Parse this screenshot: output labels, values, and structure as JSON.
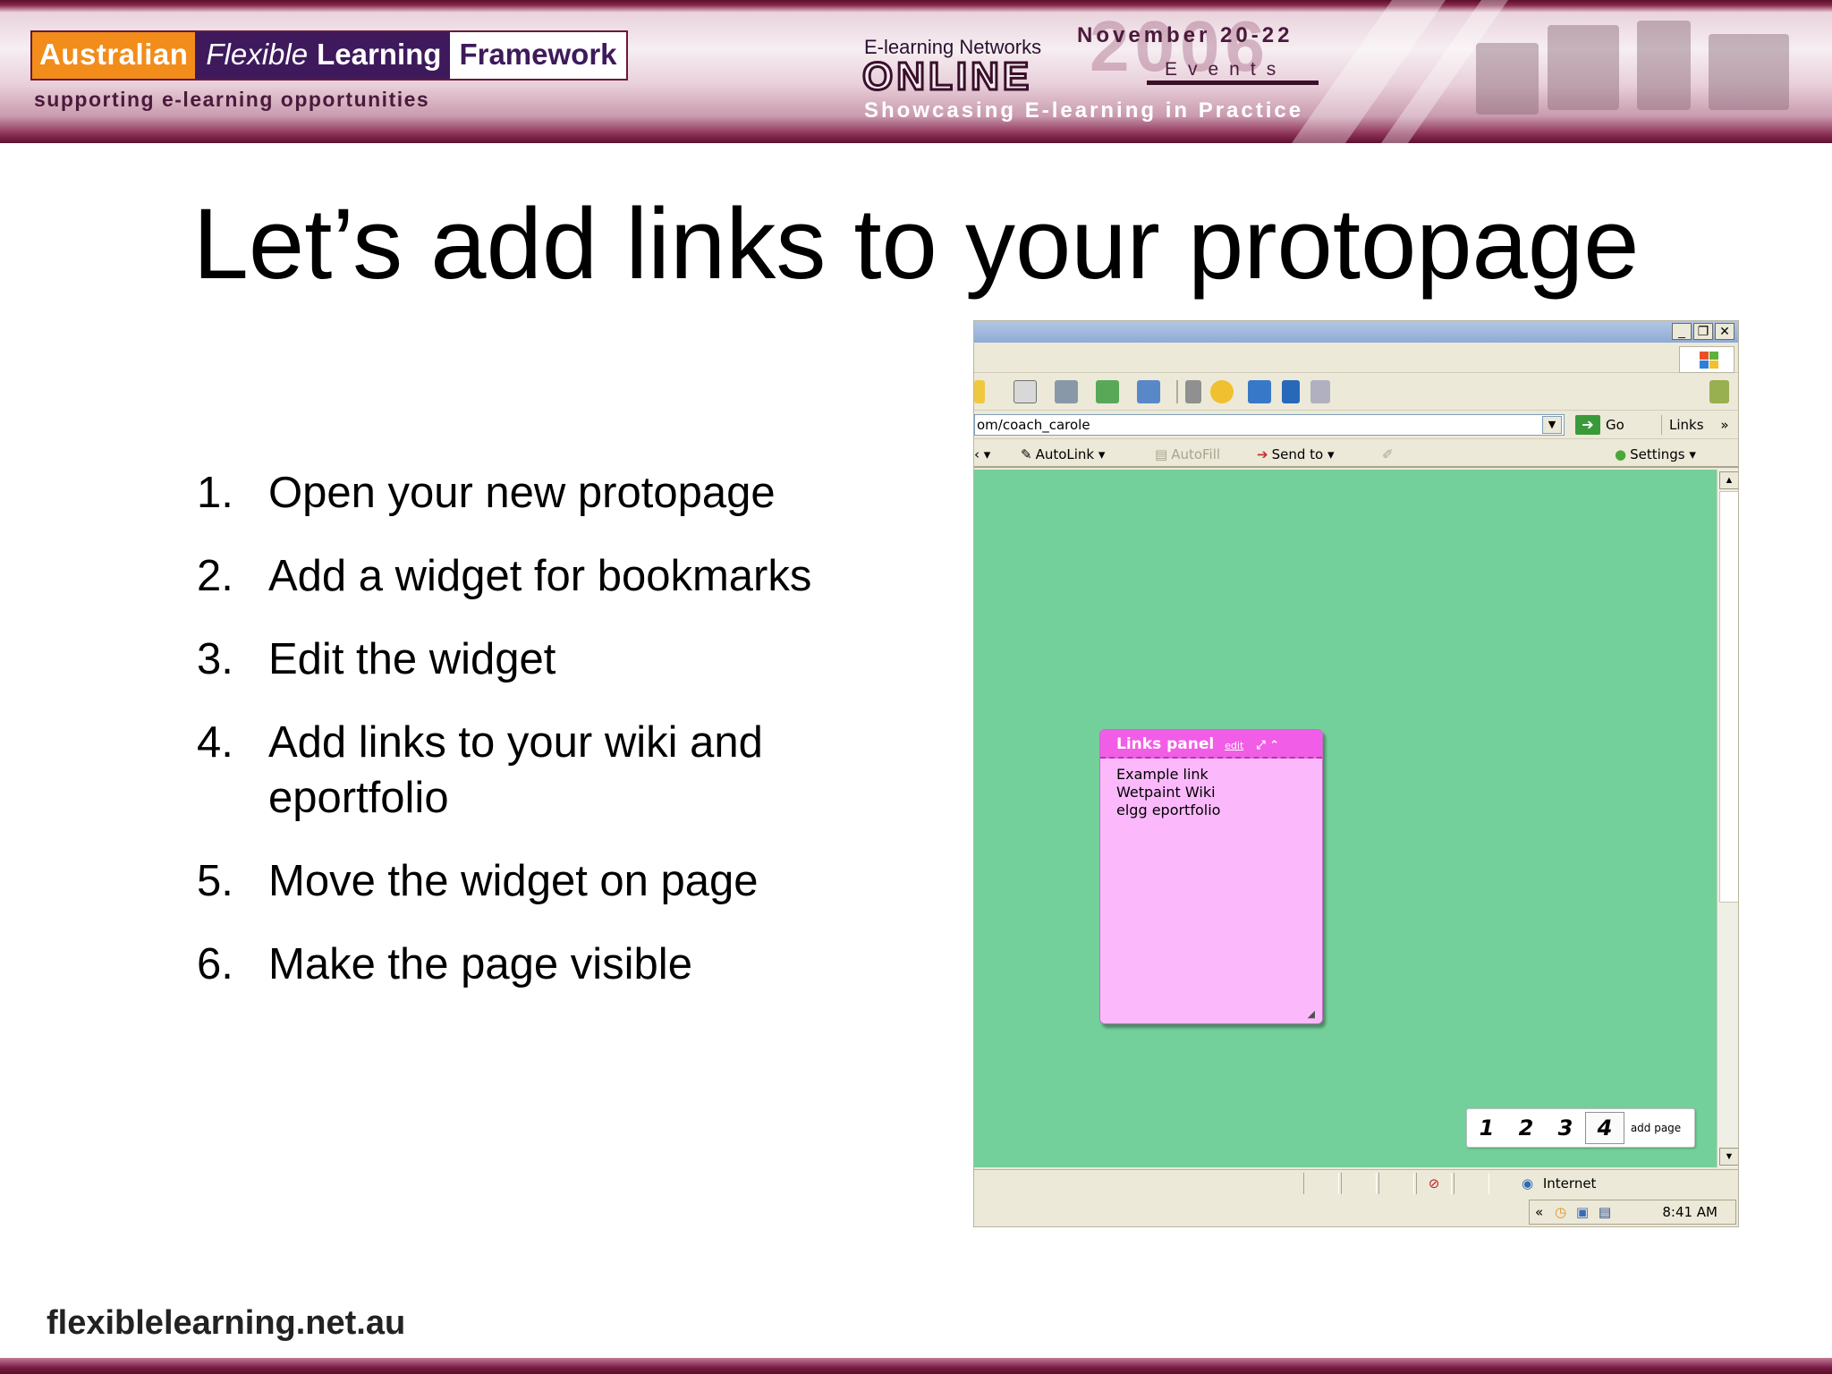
{
  "header": {
    "aflf_words": [
      "Australian",
      "Flexible",
      "Learning",
      "Framework"
    ],
    "tagline": "supporting e-learning opportunities",
    "eln_label": "E-learning Networks",
    "event_dates": "November 20-22",
    "event_year": "2006",
    "online_word": "ONLINE",
    "events_word": "Events",
    "showcase": "Showcasing E-learning in Practice"
  },
  "title": "Let’s add links to your protopage",
  "steps": [
    {
      "num": "1.",
      "text": "Open your new protopage"
    },
    {
      "num": "2.",
      "text": "Add a widget for bookmarks"
    },
    {
      "num": "3.",
      "text": "Edit the widget"
    },
    {
      "num": "4.",
      "text": "Add links to your wiki and eportfolio"
    },
    {
      "num": "5.",
      "text": "Move the widget on page"
    },
    {
      "num": "6.",
      "text": "Make the page visible"
    }
  ],
  "browser": {
    "window_buttons": [
      "_",
      "❐",
      "✕"
    ],
    "address": "om/coach_carole",
    "go_label": "Go",
    "links_label": "Links",
    "links_chevron": "»",
    "googlebar": {
      "autolink": "AutoLink",
      "autofill": "AutoFill",
      "sendto": "Send to",
      "settings": "Settings"
    },
    "widget": {
      "title": "Links panel",
      "edit_label": "edit",
      "links": [
        "Example link",
        "Wetpaint Wiki",
        "elgg eportfolio"
      ]
    },
    "page_tabs": [
      "1",
      "2",
      "3",
      "4"
    ],
    "active_tab": "4",
    "add_page_label": "add page",
    "status_zone": "Internet",
    "clock": "8:41 AM",
    "tray_chevron": "«"
  },
  "footer": {
    "url": "flexiblelearning.net.au"
  },
  "colors": {
    "page_green": "#74d09b",
    "widget_pink": "#fbb9fb",
    "widget_header": "#f15de6",
    "banner_maroon": "#7a1c44",
    "aflf_orange": "#f28c1a",
    "aflf_purple": "#3e1a5c"
  }
}
